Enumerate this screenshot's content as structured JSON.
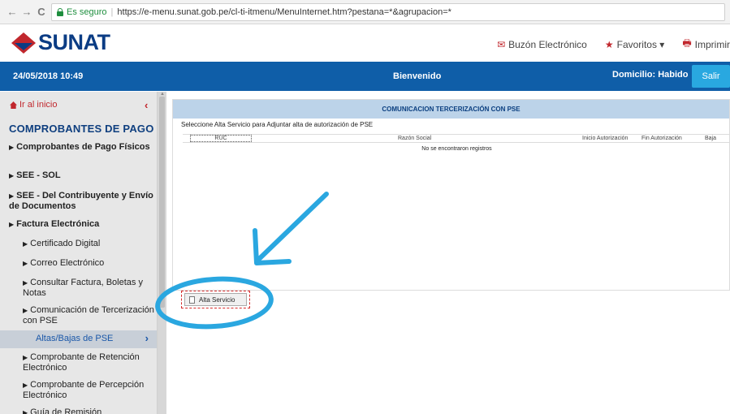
{
  "browser": {
    "back": "←",
    "forward": "→",
    "reload": "C",
    "secure_label": "Es seguro",
    "url": "https://e-menu.sunat.gob.pe/cl-ti-itmenu/MenuInternet.htm?pestana=*&agrupacion=*"
  },
  "header": {
    "logo_text": "SUNAT",
    "links": [
      {
        "icon": "envelope-icon",
        "label": "Buzón Electrónico"
      },
      {
        "icon": "star-icon",
        "label": "Favoritos ▾"
      },
      {
        "icon": "printer-icon",
        "label": "Imprimir"
      }
    ]
  },
  "blue_bar": {
    "datetime": "24/05/2018 10:49",
    "welcome": "Bienvenido",
    "domicilio": "Domicilio: Habido",
    "logout": "Salir"
  },
  "sidebar": {
    "home_link": "Ir al inicio",
    "section_title": "COMPROBANTES DE PAGO",
    "items": [
      {
        "label": "Comprobantes de Pago Físicos"
      },
      {
        "label": "SEE - SOL"
      },
      {
        "label": "SEE - Del Contribuyente y Envío de Documentos"
      },
      {
        "label": "Factura Electrónica"
      },
      {
        "label": "Certificado Digital"
      },
      {
        "label": "Correo Electrónico"
      },
      {
        "label": "Consultar Factura, Boletas y Notas"
      },
      {
        "label": "Comunicación de Tercerización con PSE"
      },
      {
        "label": "Altas/Bajas de PSE"
      },
      {
        "label": "Comprobante de Retención Electrónico"
      },
      {
        "label": "Comprobante de Percepción Electrónico"
      },
      {
        "label": "Guía de Remisión"
      }
    ]
  },
  "main": {
    "panel_title": "COMUNICACION TERCERIZACIÓN CON PSE",
    "instructions": "Seleccione Alta Servicio para Adjuntar alta de autorización de PSE",
    "columns": [
      "RUC",
      "Razón Social",
      "Inicio Autorización",
      "Fin Autorización",
      "Baja"
    ],
    "empty_message": "No se encontraron registros",
    "alta_button": "Alta Servicio"
  },
  "colors": {
    "brand_blue": "#0f5ea8",
    "logout_blue": "#29a8e0",
    "sidebar_bg": "#e7e7e7",
    "annotation_blue": "#2aa7e0",
    "highlight_red": "#d62b2b"
  }
}
